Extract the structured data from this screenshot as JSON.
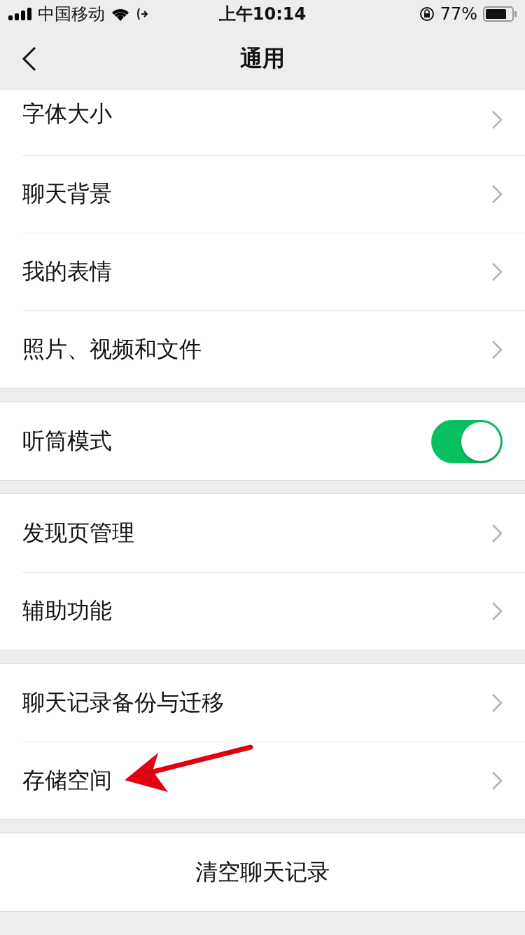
{
  "status_bar": {
    "carrier": "中国移动",
    "time": "上午10:14",
    "battery": "77%"
  },
  "nav": {
    "title": "通用"
  },
  "groups": [
    {
      "items": [
        {
          "kind": "link",
          "label": "字体大小"
        },
        {
          "kind": "link",
          "label": "聊天背景"
        },
        {
          "kind": "link",
          "label": "我的表情"
        },
        {
          "kind": "link",
          "label": "照片、视频和文件"
        }
      ]
    },
    {
      "items": [
        {
          "kind": "toggle",
          "label": "听筒模式",
          "on": true
        }
      ]
    },
    {
      "items": [
        {
          "kind": "link",
          "label": "发现页管理"
        },
        {
          "kind": "link",
          "label": "辅助功能"
        }
      ]
    },
    {
      "items": [
        {
          "kind": "link",
          "label": "聊天记录备份与迁移"
        },
        {
          "kind": "link",
          "label": "存储空间",
          "arrow": true
        }
      ]
    },
    {
      "items": [
        {
          "kind": "action",
          "label": "清空聊天记录"
        }
      ]
    }
  ]
}
